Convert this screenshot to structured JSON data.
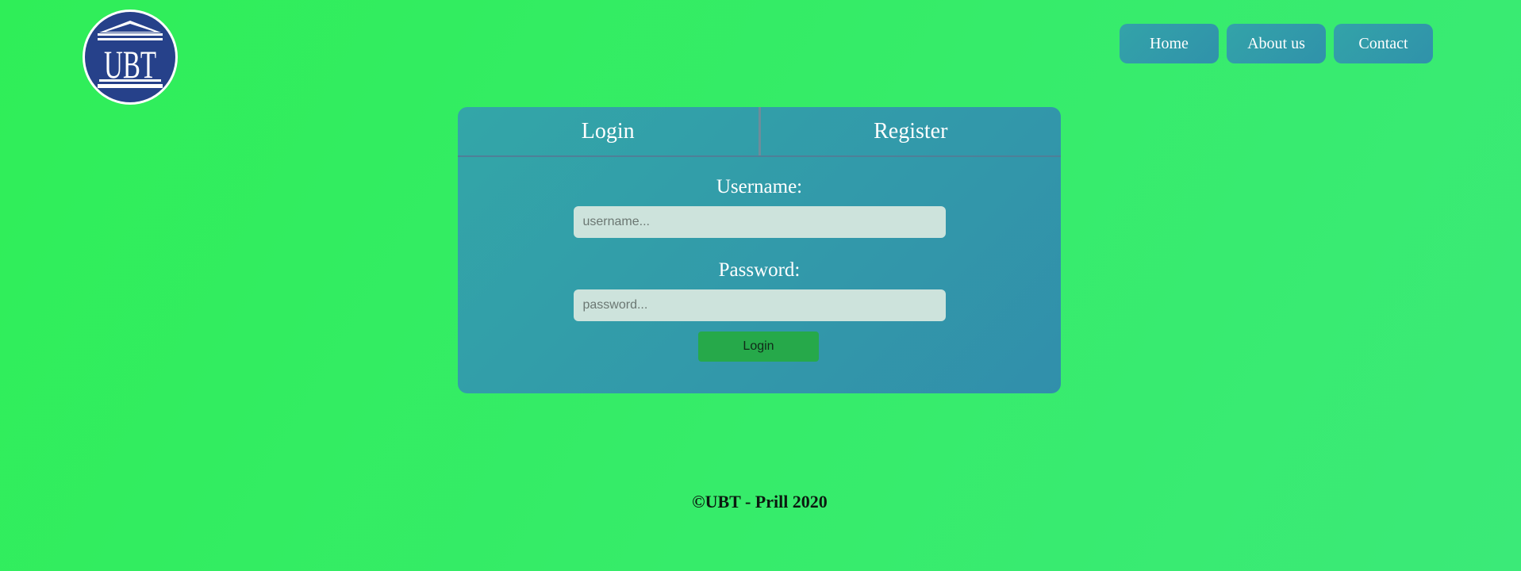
{
  "logo": {
    "text": "UBT",
    "colors": {
      "circle": "#26418a",
      "ring": "#ffffff"
    }
  },
  "nav": {
    "items": [
      {
        "label": "Home"
      },
      {
        "label": "About us"
      },
      {
        "label": "Contact"
      }
    ]
  },
  "auth": {
    "tabs": {
      "login": "Login",
      "register": "Register"
    },
    "username": {
      "label": "Username:",
      "placeholder": "username..."
    },
    "password": {
      "label": "Password:",
      "placeholder": "password..."
    },
    "submit_label": "Login"
  },
  "footer": {
    "text": "©UBT - Prill 2020"
  },
  "colors": {
    "background": "#33ed62",
    "card": "#3199a9",
    "nav_button": "#3299a9",
    "submit_button": "#26a94a",
    "input": "#cde3dc"
  }
}
